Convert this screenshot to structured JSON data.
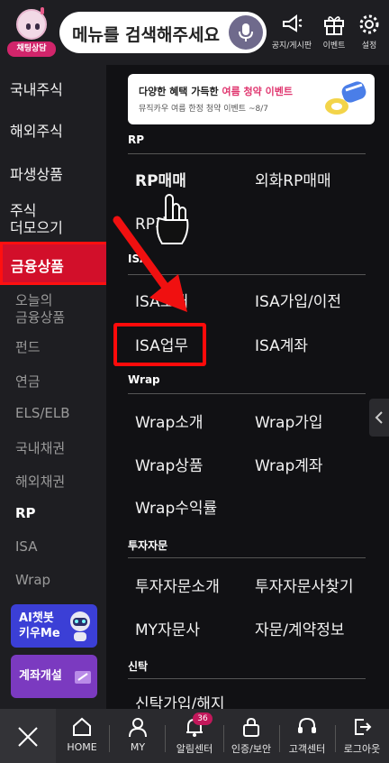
{
  "header": {
    "chatbot_label": "채팅상담",
    "search_placeholder": "메뉴를 검색해주세요",
    "icons": [
      {
        "name": "megaphone-icon",
        "label": "공지/게시판"
      },
      {
        "name": "gift-icon",
        "label": "이벤트"
      },
      {
        "name": "gear-icon",
        "label": "설정"
      }
    ]
  },
  "sidebar": {
    "items": [
      "국내주식",
      "해외주식",
      "파생상품",
      "주식\n더모으기",
      "금융상품"
    ],
    "active": "금융상품",
    "subitems": [
      "오늘의\n금융상품",
      "펀드",
      "연금",
      "ELS/ELB",
      "국내채권",
      "해외채권",
      "RP",
      "ISA",
      "Wrap"
    ],
    "active_sub": "RP",
    "promo1": "AI챗봇\n키우Me",
    "promo2": "계좌개설"
  },
  "banner": {
    "title_prefix": "다양한 혜택 가득한",
    "title_highlight": "여름 청약 이벤트",
    "subtitle": "뮤직카우 여름 한정 청약 이벤트 ~8/7"
  },
  "sections": [
    {
      "title": "RP",
      "items": [
        "RP매매",
        "외화RP매매",
        "RP계좌"
      ]
    },
    {
      "title": "ISA",
      "items": [
        "ISA소개",
        "ISA가입/이전",
        "ISA업무",
        "ISA계좌"
      ]
    },
    {
      "title": "Wrap",
      "items": [
        "Wrap소개",
        "Wrap가입",
        "Wrap상품",
        "Wrap계좌",
        "Wrap수익률"
      ]
    },
    {
      "title": "투자자문",
      "items": [
        "투자자문소개",
        "투자자문사찾기",
        "MY자문사",
        "자문/계약정보"
      ]
    },
    {
      "title": "신탁",
      "items": [
        "신탁가입/해지"
      ]
    }
  ],
  "bottom_nav": {
    "items": [
      "HOME",
      "MY",
      "알림센터",
      "인증/보안",
      "고객센터",
      "로그아웃"
    ],
    "notification_count": "36"
  },
  "colors": {
    "accent_red": "#d20f2a",
    "highlight_border": "#ff0a0a",
    "badge": "#c2185b"
  }
}
